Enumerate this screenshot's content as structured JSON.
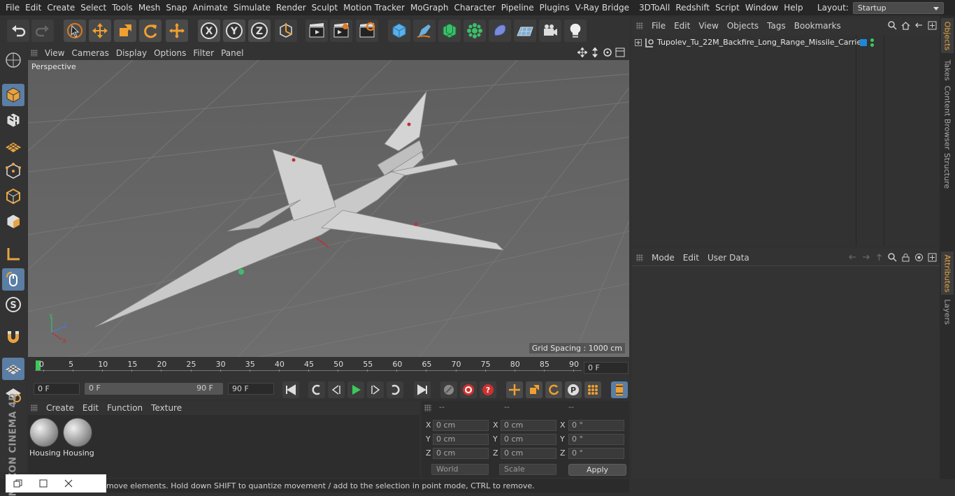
{
  "menubar": {
    "items": [
      "File",
      "Edit",
      "Create",
      "Select",
      "Tools",
      "Mesh",
      "Snap",
      "Animate",
      "Simulate",
      "Render",
      "Sculpt",
      "Motion Tracker",
      "MoGraph",
      "Character",
      "Pipeline",
      "Plugins",
      "V-Ray Bridge",
      "3DToAll",
      "Redshift",
      "Script",
      "Window",
      "Help"
    ],
    "layout_label": "Layout:",
    "layout_value": "Startup"
  },
  "toolbar": {
    "icons": [
      "undo-icon",
      "redo-icon",
      "live-selection-icon",
      "move-icon",
      "scale-icon",
      "rotate-icon",
      "move-tool-icon",
      "x-axis-icon",
      "y-axis-icon",
      "z-axis-icon",
      "coordinate-system-icon",
      "render-view-icon",
      "render-picture-viewer-icon",
      "edit-render-settings-icon",
      "cube-icon",
      "pen-icon",
      "subdivision-icon",
      "cloner-icon",
      "deformer-icon",
      "floor-icon",
      "camera-icon",
      "light-icon"
    ]
  },
  "viewport": {
    "menu": [
      "View",
      "Cameras",
      "Display",
      "Options",
      "Filter",
      "Panel"
    ],
    "label": "Perspective",
    "grid_spacing": "Grid Spacing : 1000 cm"
  },
  "timeline": {
    "ticks": [
      "0",
      "5",
      "10",
      "15",
      "20",
      "25",
      "30",
      "35",
      "40",
      "45",
      "50",
      "55",
      "60",
      "65",
      "70",
      "75",
      "80",
      "85",
      "90"
    ],
    "current_frame": "0 F"
  },
  "transport": {
    "start_frame": "0 F",
    "range_start": "0 F",
    "range_end": "90 F",
    "end_frame": "90 F"
  },
  "materials": {
    "menu": [
      "Create",
      "Edit",
      "Function",
      "Texture"
    ],
    "items": [
      {
        "label": "Housing"
      },
      {
        "label": "Housing"
      }
    ]
  },
  "coordinates": {
    "headers": [
      "--",
      "--",
      "--"
    ],
    "rows": [
      {
        "axis": "X",
        "pos": "0 cm",
        "size_axis": "X",
        "size": "0 cm",
        "rot_axis": "X",
        "rot": "0 °"
      },
      {
        "axis": "Y",
        "pos": "0 cm",
        "size_axis": "Y",
        "size": "0 cm",
        "rot_axis": "Y",
        "rot": "0 °"
      },
      {
        "axis": "Z",
        "pos": "0 cm",
        "size_axis": "Z",
        "size": "0 cm",
        "rot_axis": "Z",
        "rot": "0 °"
      }
    ],
    "mode": "World",
    "transform": "Scale",
    "apply": "Apply"
  },
  "object_manager": {
    "menu": [
      "File",
      "Edit",
      "View",
      "Objects",
      "Tags",
      "Bookmarks"
    ],
    "object_name": "Tupolev_Tu_22M_Backfire_Long_Range_Missile_Carrier"
  },
  "attribute_manager": {
    "menu": [
      "Mode",
      "Edit",
      "User Data"
    ]
  },
  "right_tabs": [
    "Objects",
    "Takes",
    "Content Browser",
    "Structure",
    "Attributes",
    "Layers"
  ],
  "status": {
    "text": "move elements. Hold down SHIFT to quantize movement / add to the selection in point mode, CTRL to remove."
  },
  "branding": {
    "logo_text": "MAXON CINEMA 4D"
  },
  "colors": {
    "accent_blue": "#5b7ea5",
    "timeline_green": "#3cc95a",
    "tab_active": "#e8a340"
  }
}
